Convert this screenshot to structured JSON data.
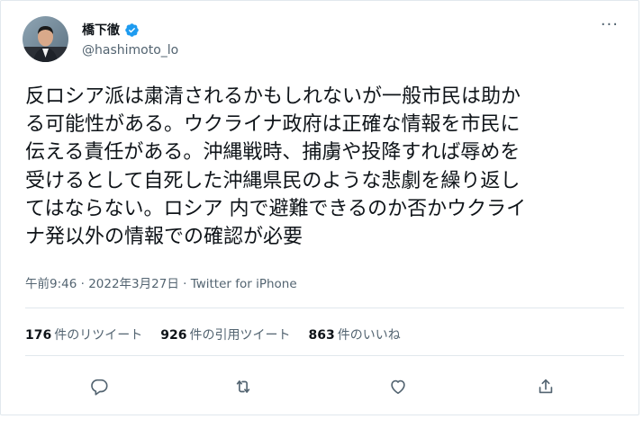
{
  "user": {
    "display_name": "橋下徹",
    "handle": "@hashimoto_lo",
    "verified_color": "#1d9bf0"
  },
  "menu_icon": "more-horizontal-icon",
  "tweet": {
    "text": "反ロシア派は粛清されるかもしれないが一般市民は助か\nる可能性がある。ウクライナ政府は正確な情報を市民に\n伝える責任がある。沖縄戦時、捕虜や投降すれば辱めを\n受けるとして自死した沖縄県民のような悲劇を繰り返し\nてはならない。ロシア 内で避難できるのか否かウクライ\nナ発以外の情報での確認が必要"
  },
  "meta": {
    "time": "午前9:46",
    "sep1": " · ",
    "date": "2022年3月27日",
    "sep2": " · ",
    "source": "Twitter for iPhone"
  },
  "stats": {
    "retweets_count": "176",
    "retweets_label": "件のリツイート",
    "quotes_count": "926",
    "quotes_label": "件の引用ツイート",
    "likes_count": "863",
    "likes_label": "件のいいね"
  },
  "actions": {
    "reply_icon": "reply-icon",
    "retweet_icon": "retweet-icon",
    "like_icon": "heart-icon",
    "share_icon": "share-icon"
  },
  "colors": {
    "text": "#0f1419",
    "secondary": "#536471",
    "divider": "#e1e8ed"
  }
}
